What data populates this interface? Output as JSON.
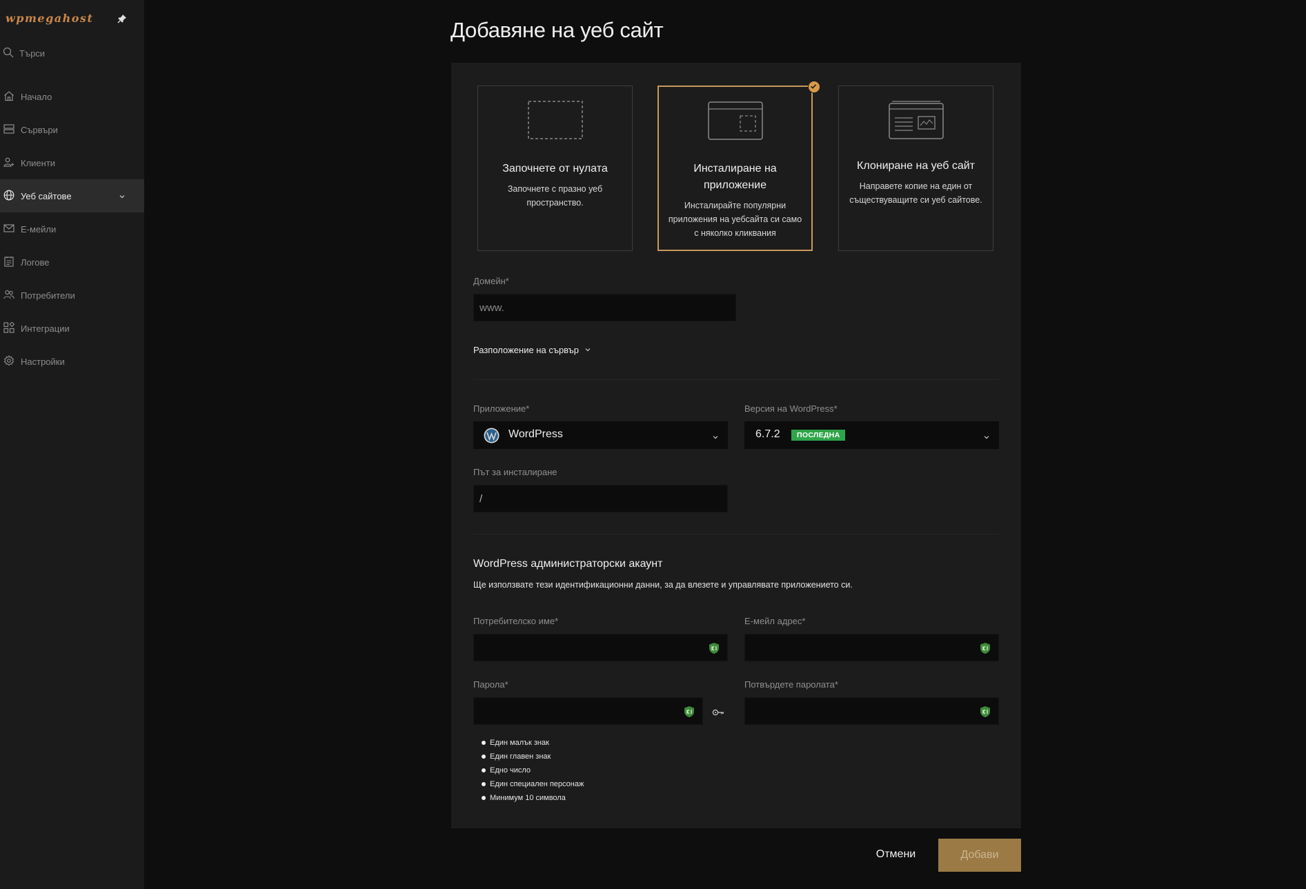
{
  "sidebar": {
    "logo": "wpmegahost",
    "search_placeholder": "Търси",
    "items": [
      {
        "label": "Начало",
        "icon": "home-icon"
      },
      {
        "label": "Сървъри",
        "icon": "server-icon"
      },
      {
        "label": "Клиенти",
        "icon": "clients-icon"
      },
      {
        "label": "Уеб сайтове",
        "icon": "globe-icon",
        "active": true
      },
      {
        "label": "Е-мейли",
        "icon": "mail-icon"
      },
      {
        "label": "Логове",
        "icon": "logs-icon"
      },
      {
        "label": "Потребители",
        "icon": "users-icon"
      },
      {
        "label": "Интеграции",
        "icon": "integrations-icon"
      },
      {
        "label": "Настройки",
        "icon": "gear-icon"
      }
    ]
  },
  "page": {
    "title": "Добавяне на уеб сайт"
  },
  "cards": [
    {
      "title": "Започнете от нулата",
      "desc": "Започнете с празно уеб пространство.",
      "selected": false
    },
    {
      "title": "Инсталиране на приложение",
      "desc": "Инсталирайте популярни приложения на уебсайта си само с няколко кликвания",
      "selected": true
    },
    {
      "title": "Клониране на уеб сайт",
      "desc": "Направете копие на един от съществуващите си уеб сайтове.",
      "selected": false
    }
  ],
  "form": {
    "domain_label": "Домейн*",
    "domain_prefix": "www.",
    "server_location": "Разположение на сървър",
    "app_label": "Приложение*",
    "app_value": "WordPress",
    "wp_version_label": "Версия на WordPress*",
    "wp_version_value": "6.7.2",
    "wp_version_badge": "ПОСЛЕДНА",
    "path_label": "Път за инсталиране",
    "path_value": "/",
    "admin_heading": "WordPress администраторски акаунт",
    "admin_desc": "Ще използвате тези идентификационни данни, за да влезете и управлявате приложението си.",
    "username_label": "Потребителско име*",
    "email_label": "Е-мейл адрес*",
    "password_label": "Парола*",
    "confirm_label": "Потвърдете паролата*",
    "password_rules": [
      "Един малък знак",
      "Един главен знак",
      "Едно число",
      "Един специален персонаж",
      "Минимум 10 символа"
    ]
  },
  "actions": {
    "cancel": "Отмени",
    "add": "Добави"
  },
  "colors": {
    "accent": "#c89a5a",
    "badge": "#2fa54a",
    "add_button": "#9c7a45",
    "shield": "#3e8a3a"
  }
}
